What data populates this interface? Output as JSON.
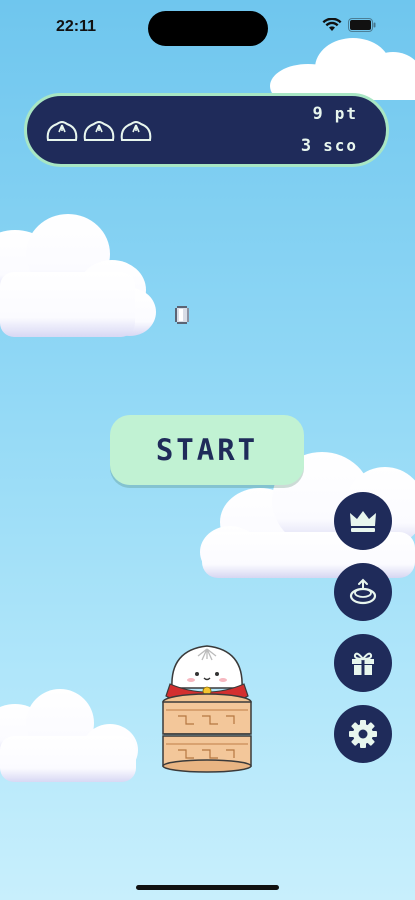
{
  "status_bar": {
    "time": "22:11"
  },
  "score_panel": {
    "lives": 3,
    "points_value": "9",
    "points_unit": "pt",
    "score_value": "3",
    "score_unit": "sco"
  },
  "start_button": {
    "label": "START"
  },
  "side_buttons": [
    "crown-icon",
    "steamer-icon",
    "gift-icon",
    "gear-icon"
  ],
  "colors": {
    "panel_bg": "#1f2b5a",
    "panel_border": "#a8e6c4",
    "start_bg": "#c1f2d3",
    "sky_top": "#6fc6ee",
    "sky_bottom": "#c8effc"
  }
}
